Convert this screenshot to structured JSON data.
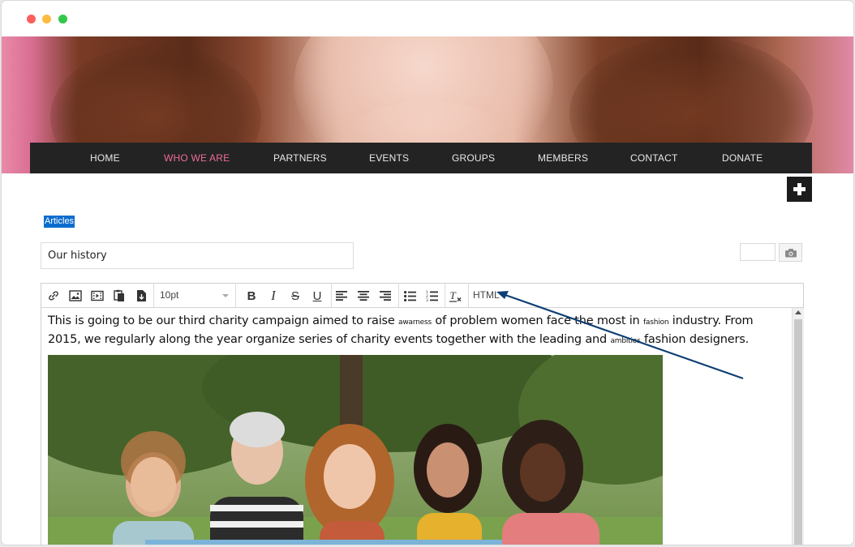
{
  "window": {
    "controls": [
      "close",
      "minimize",
      "maximize"
    ],
    "colors": {
      "close": "#fc605c",
      "minimize": "#fdbc40",
      "maximize": "#34c84a"
    }
  },
  "nav": {
    "items": [
      {
        "label": "HOME"
      },
      {
        "label": "WHO WE ARE",
        "active": true
      },
      {
        "label": "PARTNERS"
      },
      {
        "label": "EVENTS"
      },
      {
        "label": "GROUPS"
      },
      {
        "label": "MEMBERS"
      },
      {
        "label": "CONTACT"
      },
      {
        "label": "DONATE"
      }
    ],
    "active_color": "#ec6c95"
  },
  "breadcrumb": {
    "label": "Articles"
  },
  "article": {
    "title": "Our history"
  },
  "toolbar": {
    "buttons": [
      "link-icon",
      "image-icon",
      "video-icon",
      "paste-icon",
      "paste-text-icon"
    ],
    "font_size": "10pt",
    "format_buttons": [
      "bold-icon",
      "italic-icon",
      "strikethrough-icon",
      "underline-icon"
    ],
    "align_buttons": [
      "align-left-icon",
      "align-center-icon",
      "align-right-icon"
    ],
    "list_buttons": [
      "bullet-list-icon",
      "numbered-list-icon"
    ],
    "clear_format": "clear-format-icon",
    "html_label": "HTML"
  },
  "editor": {
    "text_1": "This is going to be our third charity campaign aimed to raise",
    "small_1": "awarness",
    "text_2": "of problem women face the most in",
    "small_2": "fashion",
    "text_3": "industry. From 2015, we regularly along the year organize series of charity events together with the leading and",
    "small_3": "ambitios",
    "text_4": "fashion designers."
  },
  "annotation": {
    "arrow_color": "#0d3f73"
  }
}
